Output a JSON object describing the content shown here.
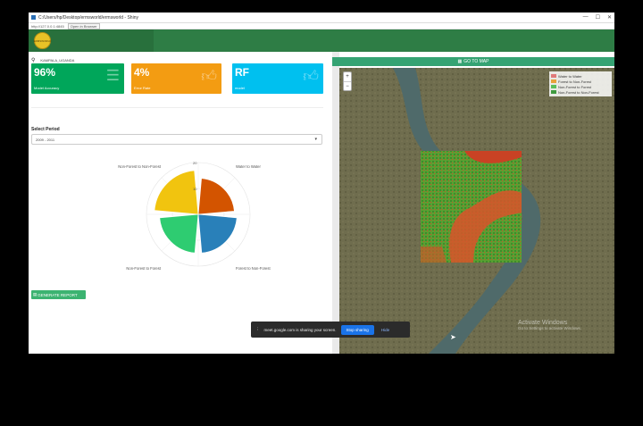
{
  "window": {
    "title": "C:/Users/hp/Desktop/ermsworld/ermsworld - Shiny",
    "address": "http://127.0.0.1:4845",
    "open_in_browser": "Open in Browser",
    "controls": [
      "—",
      "☐",
      "✕"
    ]
  },
  "header": {
    "logo_text": "ERMSWORLD"
  },
  "location": {
    "label": "KAMPALA_UGANDA"
  },
  "cards": [
    {
      "value": "96%",
      "label": "Model Accuracy",
      "color": "#00a65a",
      "icon": "list-icon"
    },
    {
      "value": "4%",
      "label": "Error Rate",
      "color": "#f39c12",
      "icon": "thumbs-up-icon"
    },
    {
      "value": "RF",
      "label": "model",
      "color": "#00c0ef",
      "icon": "thumbs-up-icon"
    }
  ],
  "period": {
    "label": "Select Period",
    "selected": "2009 - 2011"
  },
  "chart_data": {
    "type": "polar_bar",
    "categories": [
      "Water to Water",
      "Forest to Non-Forest",
      "Non-Forest to Forest",
      "Non-Forest to Non-Forest"
    ],
    "values": [
      14,
      15,
      15,
      17
    ],
    "colors": [
      "#d35400",
      "#2980b9",
      "#2ecc71",
      "#f1c40f"
    ],
    "radial_ticks": [
      20,
      10
    ],
    "rmax": 20
  },
  "report_button": {
    "label": "GENERATE REPORT"
  },
  "map_button": {
    "label": "GO TO MAP"
  },
  "map": {
    "zoom_in": "+",
    "zoom_out": "−",
    "legend": [
      {
        "label": "Water to Water",
        "color": "#e07a7a"
      },
      {
        "label": "Forest to Non-Forest",
        "color": "#e8a23a"
      },
      {
        "label": "Non-Forest to Forest",
        "color": "#5bbf5b"
      },
      {
        "label": "Non-Forest to Non-Forest",
        "color": "#3f9a3f"
      }
    ]
  },
  "watermark": {
    "line1": "Activate Windows",
    "line2": "Go to Settings to activate Windows."
  },
  "share_bar": {
    "text": "meet.google.com is sharing your screen.",
    "stop": "Stop sharing",
    "hide": "Hide"
  }
}
